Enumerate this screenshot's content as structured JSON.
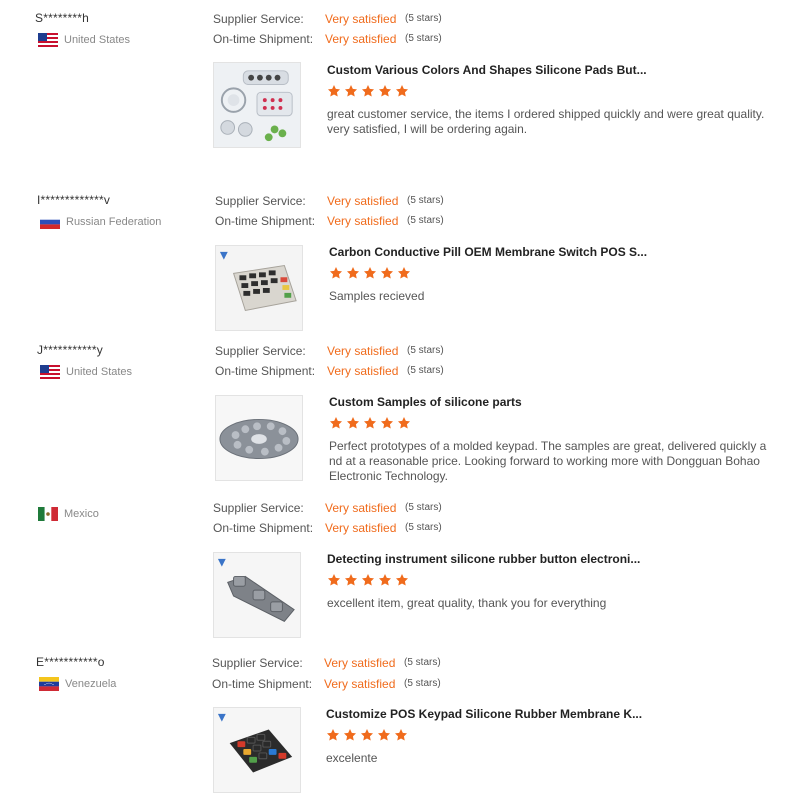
{
  "colors": {
    "accent": "#f06b1c",
    "text": "#333333",
    "muted": "#888888"
  },
  "labels": {
    "supplier_service": "Supplier Service:",
    "on_time_shipment": "On-time Shipment:"
  },
  "reviews": [
    {
      "buyer": "S********h",
      "country": "United States",
      "flag_icon": "us-flag-icon",
      "supplier_service": "Very satisfied",
      "supplier_service_stars": "(5 stars)",
      "shipment": "Very satisfied",
      "shipment_stars": "(5 stars)",
      "product_title": "Custom Various Colors And Shapes Silicone Pads But...",
      "product_rating": 5,
      "text": "great customer service, the items I ordered shipped quickly and were great quality. very satisfied, I will be ordering again."
    },
    {
      "buyer": "I*************v",
      "country": "Russian Federation",
      "flag_icon": "russia-flag-icon",
      "supplier_service": "Very satisfied",
      "supplier_service_stars": "(5 stars)",
      "shipment": "Very satisfied",
      "shipment_stars": "(5 stars)",
      "product_title": "Carbon Conductive Pill OEM Membrane Switch POS S...",
      "product_rating": 5,
      "text": "Samples recieved"
    },
    {
      "buyer": "J***********y",
      "country": "United States",
      "flag_icon": "us-flag-icon",
      "supplier_service": "Very satisfied",
      "supplier_service_stars": "(5 stars)",
      "shipment": "Very satisfied",
      "shipment_stars": "(5 stars)",
      "product_title": "Custom Samples of silicone parts",
      "product_rating": 5,
      "text": "Perfect prototypes of a molded keypad.  The samples are great, delivered quickly and at a reasonable price.  Looking forward to working more with Dongguan Bohao Electronic Technology."
    },
    {
      "buyer": "",
      "country": "Mexico",
      "flag_icon": "mexico-flag-icon",
      "supplier_service": "Very satisfied",
      "supplier_service_stars": "(5 stars)",
      "shipment": "Very satisfied",
      "shipment_stars": "(5 stars)",
      "product_title": "Detecting instrument silicone rubber button electroni...",
      "product_rating": 5,
      "text": "excellent item, great quality, thank you for everything"
    },
    {
      "buyer": "E***********o",
      "country": "Venezuela",
      "flag_icon": "venezuela-flag-icon",
      "supplier_service": "Very satisfied",
      "supplier_service_stars": "(5 stars)",
      "shipment": "Very satisfied",
      "shipment_stars": "(5 stars)",
      "product_title": "Customize POS Keypad Silicone Rubber Membrane K...",
      "product_rating": 5,
      "text": "excelente"
    }
  ]
}
